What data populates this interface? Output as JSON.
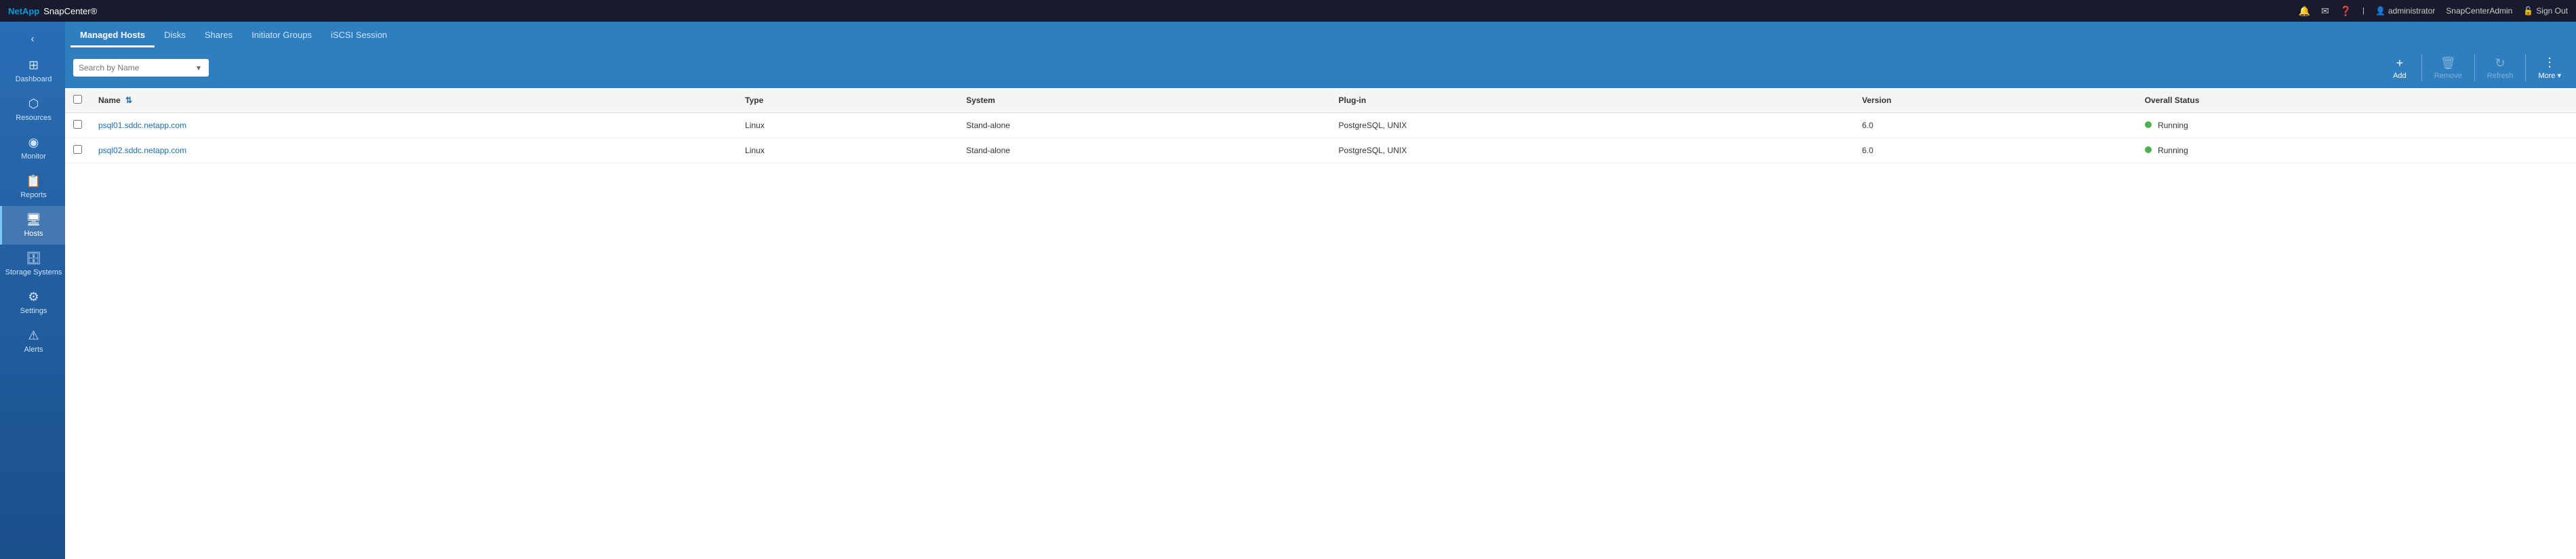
{
  "app": {
    "logo": "NetApp",
    "name": "SnapCenter®"
  },
  "topbar": {
    "icons": [
      "bell-icon",
      "mail-icon",
      "help-icon"
    ],
    "user_icon": "👤",
    "username": "administrator",
    "tenant": "SnapCenterAdmin",
    "signout_label": "Sign Out",
    "signout_icon": "🔓"
  },
  "sidebar": {
    "collapse_icon": "‹",
    "items": [
      {
        "id": "dashboard",
        "label": "Dashboard",
        "icon": "⊞",
        "active": false
      },
      {
        "id": "resources",
        "label": "Resources",
        "icon": "⬡",
        "active": false
      },
      {
        "id": "monitor",
        "label": "Monitor",
        "icon": "◉",
        "active": false
      },
      {
        "id": "reports",
        "label": "Reports",
        "icon": "📋",
        "active": false
      },
      {
        "id": "hosts",
        "label": "Hosts",
        "icon": "🖥",
        "active": true
      },
      {
        "id": "storage-systems",
        "label": "Storage Systems",
        "icon": "🗄",
        "active": false
      },
      {
        "id": "settings",
        "label": "Settings",
        "icon": "⚙",
        "active": false
      },
      {
        "id": "alerts",
        "label": "Alerts",
        "icon": "⚠",
        "active": false
      }
    ]
  },
  "subnav": {
    "tabs": [
      {
        "id": "managed-hosts",
        "label": "Managed Hosts",
        "active": true
      },
      {
        "id": "disks",
        "label": "Disks",
        "active": false
      },
      {
        "id": "shares",
        "label": "Shares",
        "active": false
      },
      {
        "id": "initiator-groups",
        "label": "Initiator Groups",
        "active": false
      },
      {
        "id": "iscsi-session",
        "label": "iSCSI Session",
        "active": false
      }
    ]
  },
  "toolbar": {
    "search_placeholder": "Search by Name",
    "filter_icon": "▾",
    "buttons": [
      {
        "id": "add",
        "label": "Add",
        "icon": "+",
        "disabled": false
      },
      {
        "id": "remove",
        "label": "Remove",
        "icon": "🗑",
        "disabled": true
      },
      {
        "id": "refresh",
        "label": "Refresh",
        "icon": "↻",
        "disabled": true
      },
      {
        "id": "more",
        "label": "More ▾",
        "icon": "⋮",
        "disabled": false
      }
    ]
  },
  "table": {
    "columns": [
      {
        "id": "checkbox",
        "label": ""
      },
      {
        "id": "name",
        "label": "Name"
      },
      {
        "id": "type",
        "label": "Type"
      },
      {
        "id": "system",
        "label": "System"
      },
      {
        "id": "plugin",
        "label": "Plug-in"
      },
      {
        "id": "version",
        "label": "Version"
      },
      {
        "id": "status",
        "label": "Overall Status"
      }
    ],
    "rows": [
      {
        "name": "psql01.sddc.netapp.com",
        "type": "Linux",
        "system": "Stand-alone",
        "plugin": "PostgreSQL, UNIX",
        "version": "6.0",
        "status": "Running"
      },
      {
        "name": "psql02.sddc.netapp.com",
        "type": "Linux",
        "system": "Stand-alone",
        "plugin": "PostgreSQL, UNIX",
        "version": "6.0",
        "status": "Running"
      }
    ]
  }
}
